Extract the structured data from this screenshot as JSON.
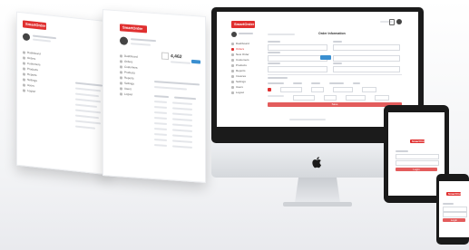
{
  "brand": {
    "logo_text": "SmartOrder",
    "accent": "#e03030"
  },
  "screen_a": {
    "menu_items": [
      "Dashboard",
      "Orders",
      "Customers",
      "Products",
      "Reports",
      "Settings",
      "Users",
      "Logout"
    ]
  },
  "screen_b": {
    "stat_value": "4,462",
    "menu_items": [
      "Dashboard",
      "Orders",
      "Customers",
      "Products",
      "Reports",
      "Settings",
      "Users",
      "Logout"
    ]
  },
  "imac": {
    "section_title": "Order Information",
    "submit_label": "Save",
    "menu_items": [
      "Dashboard",
      "Orders",
      "New Order",
      "Customers",
      "Products",
      "Reports",
      "Invoices",
      "Settings",
      "Users",
      "Logout"
    ]
  },
  "tablet": {
    "button_label": "Login"
  },
  "phone": {
    "button_label": "Login"
  }
}
